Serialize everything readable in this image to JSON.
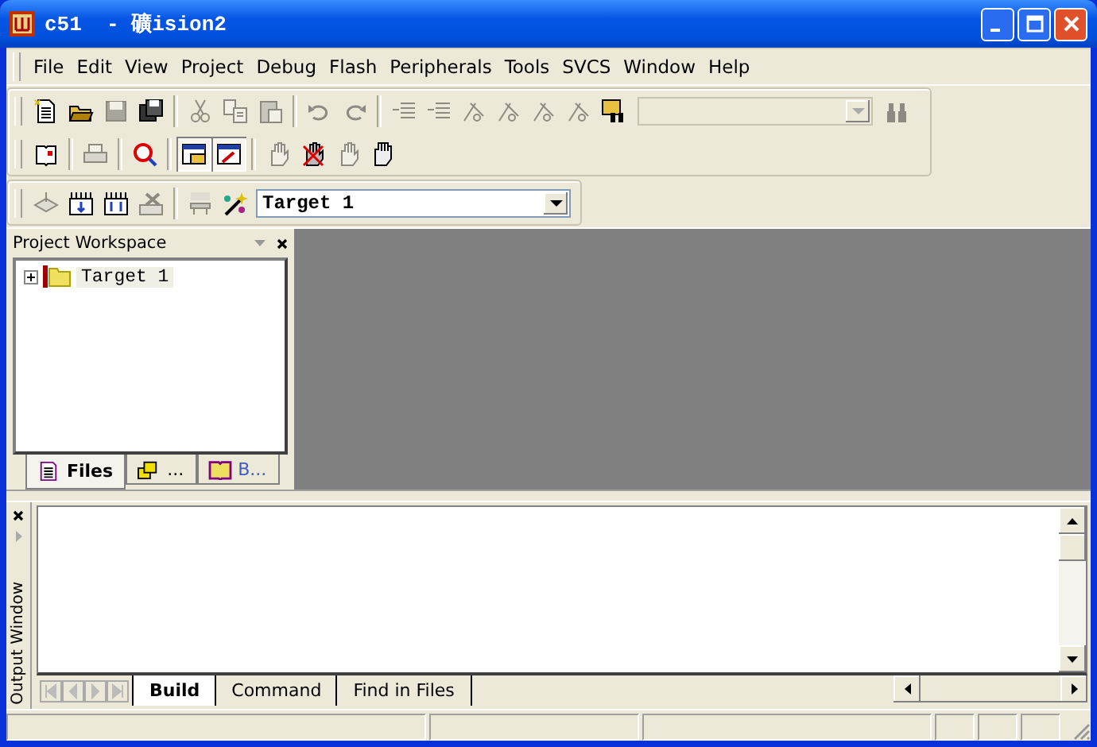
{
  "window": {
    "title": "c51  - 礦ision2"
  },
  "menu": [
    {
      "label": "File"
    },
    {
      "label": "Edit"
    },
    {
      "label": "View"
    },
    {
      "label": "Project"
    },
    {
      "label": "Debug"
    },
    {
      "label": "Flash"
    },
    {
      "label": "Peripherals"
    },
    {
      "label": "Tools"
    },
    {
      "label": "SVCS"
    },
    {
      "label": "Window"
    },
    {
      "label": "Help"
    }
  ],
  "toolbar_file": {
    "groups": [
      [
        {
          "disabled": false
        },
        {
          "disabled": false
        },
        {
          "disabled": true
        },
        {
          "disabled": false
        }
      ],
      [
        {
          "disabled": true
        },
        {
          "disabled": true
        },
        {
          "disabled": true
        }
      ],
      [
        {
          "disabled": true
        },
        {
          "disabled": true
        }
      ],
      [
        {
          "disabled": true
        },
        {
          "disabled": true
        },
        {
          "disabled": true
        },
        {
          "disabled": true
        },
        {
          "disabled": true
        },
        {
          "disabled": true
        },
        {
          "disabled": false
        }
      ]
    ],
    "find_combo": {
      "disabled": true
    },
    "find_button": {
      "disabled": true
    }
  },
  "toolbar_debug": {
    "groups": [
      [
        {
          "disabled": false,
          "pressed": false
        }
      ],
      [
        {
          "disabled": true,
          "pressed": false
        }
      ],
      [
        {
          "disabled": false,
          "pressed": false
        }
      ],
      [
        {
          "disabled": false,
          "pressed": true
        },
        {
          "disabled": false,
          "pressed": true
        }
      ],
      [
        {
          "disabled": true,
          "pressed": false
        },
        {
          "disabled": false,
          "pressed": false
        },
        {
          "disabled": true,
          "pressed": false
        },
        {
          "disabled": false,
          "pressed": false
        }
      ]
    ]
  },
  "toolbar_build": {
    "groups": [
      [
        {
          "disabled": true
        },
        {
          "disabled": false
        },
        {
          "disabled": false
        },
        {
          "disabled": true
        }
      ],
      [
        {
          "disabled": true
        },
        {
          "disabled": false
        }
      ]
    ],
    "target": "Target 1"
  },
  "workspace": {
    "title": "Project Workspace",
    "tree": [
      {
        "label": "Target 1",
        "expanded": false
      }
    ],
    "tabs": [
      {
        "label": "Files",
        "selected": true
      },
      {
        "label": "...",
        "selected": false
      },
      {
        "label": "B...",
        "selected": false
      }
    ]
  },
  "output": {
    "title": "Output Window",
    "tabs": [
      {
        "label": "Build",
        "selected": true
      },
      {
        "label": "Command",
        "selected": false
      },
      {
        "label": "Find in Files",
        "selected": false
      }
    ]
  }
}
